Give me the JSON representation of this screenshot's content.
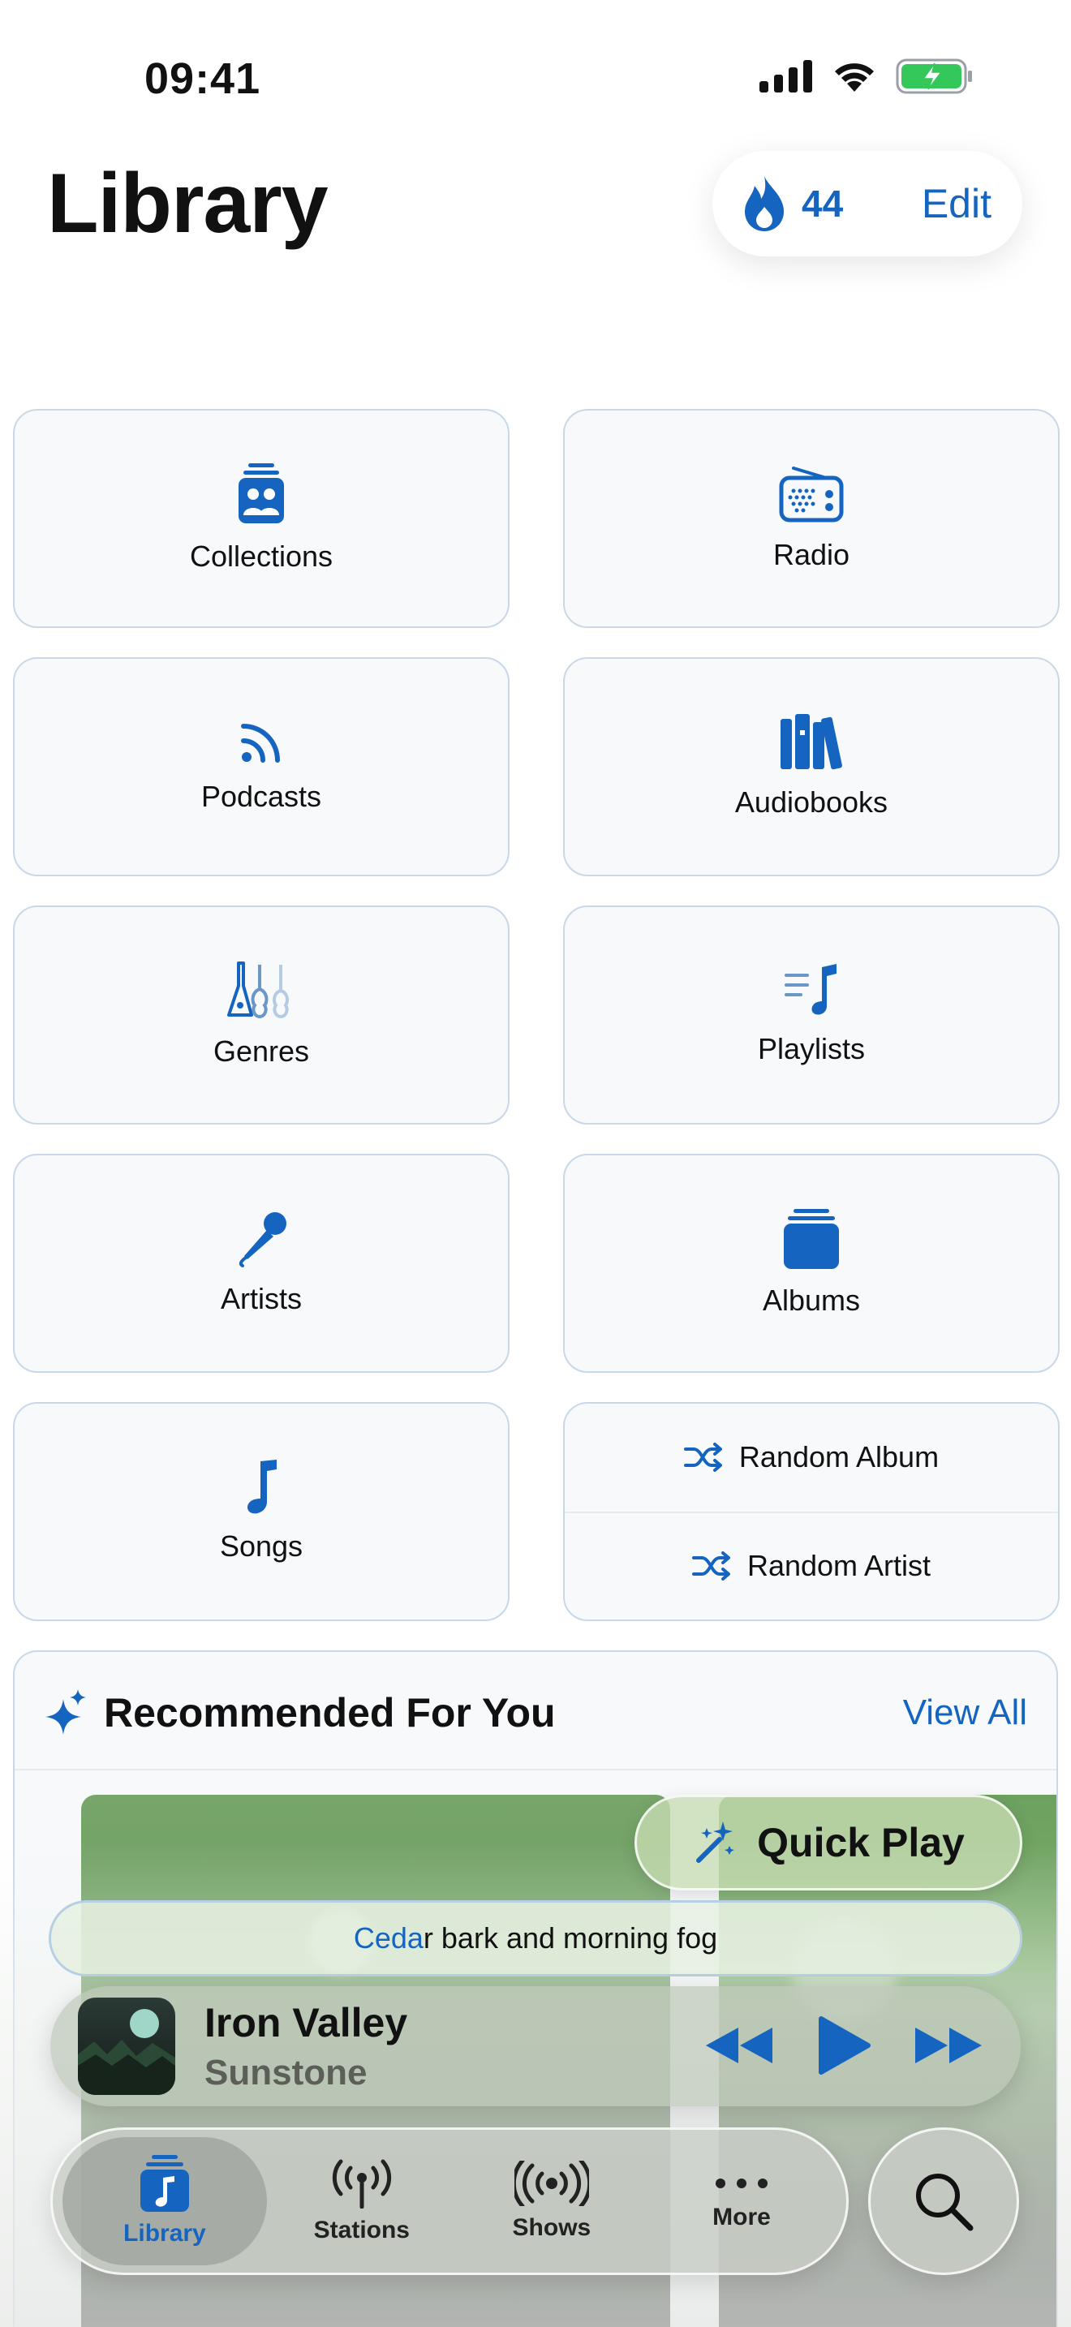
{
  "status_bar": {
    "time": "09:41"
  },
  "header": {
    "title": "Library",
    "streak_count": "44",
    "edit_label": "Edit"
  },
  "tiles": {
    "collections": "Collections",
    "radio": "Radio",
    "podcasts": "Podcasts",
    "audiobooks": "Audiobooks",
    "genres": "Genres",
    "playlists": "Playlists",
    "artists": "Artists",
    "albums": "Albums",
    "songs": "Songs",
    "random_album": "Random Album",
    "random_artist": "Random Artist"
  },
  "recommended": {
    "title": "Recommended For You",
    "view_all": "View All"
  },
  "quick_play": {
    "label": "Quick Play"
  },
  "suggestion": {
    "highlight": "Ceda",
    "rest": "r bark and morning fog"
  },
  "now_playing": {
    "title": "Iron Valley",
    "artist": "Sunstone"
  },
  "tab_bar": {
    "tabs": [
      {
        "label": "Library"
      },
      {
        "label": "Stations"
      },
      {
        "label": "Shows"
      },
      {
        "label": "More"
      }
    ]
  },
  "colors": {
    "accent": "#1565c0",
    "tile_bg": "#f7f9fb",
    "tile_border": "#c9d8e8"
  },
  "icons": {
    "status": [
      "signal-icon",
      "wifi-icon",
      "battery-charging-icon"
    ],
    "tiles": [
      "collections-icon",
      "radio-icon",
      "podcasts-icon",
      "audiobooks-icon",
      "genres-icon",
      "playlists-icon",
      "artists-icon",
      "albums-icon",
      "songs-icon",
      "shuffle-icon"
    ],
    "tabs": [
      "library-icon",
      "stations-icon",
      "shows-icon",
      "more-icon",
      "search-icon"
    ]
  }
}
